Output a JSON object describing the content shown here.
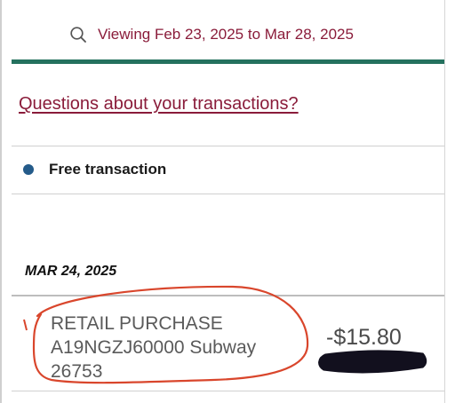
{
  "colors": {
    "brand": "#8a1c3a",
    "accent_bar": "#24715e",
    "free_dot": "#245b8a",
    "annotation": "#d9462c",
    "redaction": "#12101e"
  },
  "header": {
    "icon": "search-icon",
    "date_range": "Viewing Feb 23, 2025 to Mar 28, 2025"
  },
  "links": {
    "questions": "Questions about your transactions?"
  },
  "legend": {
    "label": "Free transaction"
  },
  "transactions": {
    "date": "MAR 24, 2025",
    "items": [
      {
        "desc_lines": [
          "RETAIL PURCHASE",
          "A19NGZJ60000 Subway",
          "26753"
        ],
        "amount": "-$15.80"
      }
    ]
  }
}
